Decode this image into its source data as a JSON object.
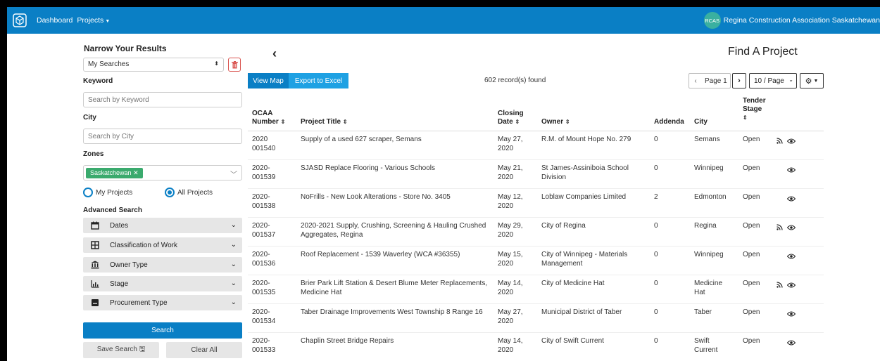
{
  "topbar": {
    "dashboard": "Dashboard",
    "projects": "Projects",
    "org_badge": "RCAS",
    "org_name": "Regina Construction Association Saskatchewan"
  },
  "sidebar": {
    "title": "Narrow Your Results",
    "my_searches": "My Searches",
    "keyword_label": "Keyword",
    "keyword_placeholder": "Search by Keyword",
    "city_label": "City",
    "city_placeholder": "Search by City",
    "zones_label": "Zones",
    "zone_chip": "Saskatchewan",
    "radio_my": "My Projects",
    "radio_all": "All Projects",
    "radio_selected": "All Projects",
    "advanced_label": "Advanced Search",
    "filters": [
      "Dates",
      "Classification of Work",
      "Owner Type",
      "Stage",
      "Procurement Type"
    ],
    "search_button": "Search",
    "save_search": "Save Search",
    "clear_all": "Clear All"
  },
  "main": {
    "page_title": "Find A Project",
    "view_map": "View Map",
    "export_excel": "Export to Excel",
    "records_found": "602 record(s) found",
    "page_label": "Page 1",
    "per_page": "10 / Page",
    "columns": {
      "number": [
        "OCAA",
        "Number"
      ],
      "title": "Project Title",
      "closing": [
        "Closing",
        "Date"
      ],
      "owner": "Owner",
      "addenda": "Addenda",
      "city": "City",
      "stage": [
        "Tender",
        "Stage"
      ]
    },
    "rows": [
      {
        "num1": "2020",
        "num2": "001540",
        "title": "Supply of a used 627 scraper, Semans",
        "date1": "May 27,",
        "date2": "2020",
        "owner": "R.M. of Mount Hope No. 279",
        "addenda": "0",
        "city": "Semans",
        "stage": "Open",
        "rss": true
      },
      {
        "num1": "2020-",
        "num2": "001539",
        "title": "SJASD Replace Flooring - Various Schools",
        "date1": "May 21,",
        "date2": "2020",
        "owner": "St James-Assiniboia School Division",
        "addenda": "0",
        "city": "Winnipeg",
        "stage": "Open",
        "rss": false
      },
      {
        "num1": "2020-",
        "num2": "001538",
        "title": "NoFrills - New Look Alterations - Store No. 3405",
        "date1": "May 12,",
        "date2": "2020",
        "owner": "Loblaw Companies Limited",
        "addenda": "2",
        "city": "Edmonton",
        "stage": "Open",
        "rss": false
      },
      {
        "num1": "2020-",
        "num2": "001537",
        "title": "2020-2021 Supply, Crushing, Screening & Hauling Crushed Aggregates, Regina",
        "date1": "May 29,",
        "date2": "2020",
        "owner": "City of Regina",
        "addenda": "0",
        "city": "Regina",
        "stage": "Open",
        "rss": true
      },
      {
        "num1": "2020-",
        "num2": "001536",
        "title": "Roof Replacement - 1539 Waverley (WCA #36355)",
        "date1": "May 15,",
        "date2": "2020",
        "owner": "City of Winnipeg - Materials Management",
        "addenda": "0",
        "city": "Winnipeg",
        "stage": "Open",
        "rss": false
      },
      {
        "num1": "2020-",
        "num2": "001535",
        "title": "Brier Park Lift Station & Desert Blume Meter Replacements, Medicine Hat",
        "date1": "May 14,",
        "date2": "2020",
        "owner": "City of Medicine Hat",
        "addenda": "0",
        "city": "Medicine Hat",
        "stage": "Open",
        "rss": true
      },
      {
        "num1": "2020-",
        "num2": "001534",
        "title": "Taber Drainage Improvements West Township 8 Range 16",
        "date1": "May 27,",
        "date2": "2020",
        "owner": "Municipal District of Taber",
        "addenda": "0",
        "city": "Taber",
        "stage": "Open",
        "rss": false
      },
      {
        "num1": "2020-",
        "num2": "001533",
        "title": "Chaplin Street Bridge Repairs",
        "date1": "May 14,",
        "date2": "2020",
        "owner": "City of Swift Current",
        "addenda": "0",
        "city": "Swift Current",
        "stage": "Open",
        "rss": false
      }
    ]
  },
  "colors": {
    "primary": "#0a7fc5",
    "export": "#1ea1e3",
    "chip": "#3aaa6d",
    "danger": "#d9534f"
  },
  "icons": [
    "cube-logo-icon",
    "trash-icon",
    "calendar-icon",
    "grid-icon",
    "bank-icon",
    "bar-chart-icon",
    "folder-icon",
    "gear-icon",
    "rss-icon",
    "eye-icon",
    "save-icon"
  ]
}
